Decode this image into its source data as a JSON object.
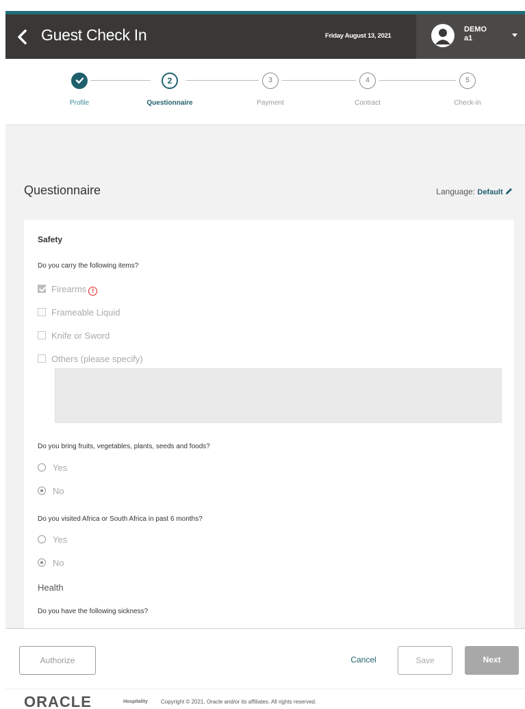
{
  "header": {
    "title": "Guest Check In",
    "date": "Friday August 13, 2021",
    "user": {
      "line1": "DEMO",
      "line2": "a1"
    }
  },
  "stepper": {
    "steps": [
      {
        "num": "",
        "label": "Profile",
        "state": "done"
      },
      {
        "num": "2",
        "label": "Questionnaire",
        "state": "active"
      },
      {
        "num": "3",
        "label": "Payment",
        "state": "pending"
      },
      {
        "num": "4",
        "label": "Contract",
        "state": "pending"
      },
      {
        "num": "5",
        "label": "Check-in",
        "state": "pending"
      }
    ]
  },
  "questionnaire": {
    "title": "Questionnaire",
    "language_label": "Language:",
    "language_value": "Default",
    "safety": {
      "title": "Safety",
      "q1": "Do you carry the following items?",
      "items": [
        {
          "label": "Firearms",
          "checked": true,
          "warning": "!"
        },
        {
          "label": "Frameable Liquid",
          "checked": false
        },
        {
          "label": "Knife or Sword",
          "checked": false
        },
        {
          "label": "Others (please specify)",
          "checked": false
        }
      ],
      "q2": "Do you bring fruits, vegetables, plants, seeds and foods?",
      "q2_options": [
        "Yes",
        "No"
      ],
      "q2_selected": "No",
      "q3": "Do you visited Africa or South Africa in past 6 months?",
      "q3_options": [
        "Yes",
        "No"
      ],
      "q3_selected": "No"
    },
    "health": {
      "title": "Health",
      "q1": "Do you have the following sickness?"
    }
  },
  "footer": {
    "authorize": "Authorize",
    "cancel": "Cancel",
    "save": "Save",
    "next": "Next",
    "brand": "ORACLE",
    "brand_sub": "Hospitality",
    "copyright": "Copyright © 2021, Oracle and/or its affiliates. All rights reserved."
  },
  "colors": {
    "header_bg": "#3a3836",
    "accent": "#1f5f6c",
    "warning": "#e02020"
  }
}
